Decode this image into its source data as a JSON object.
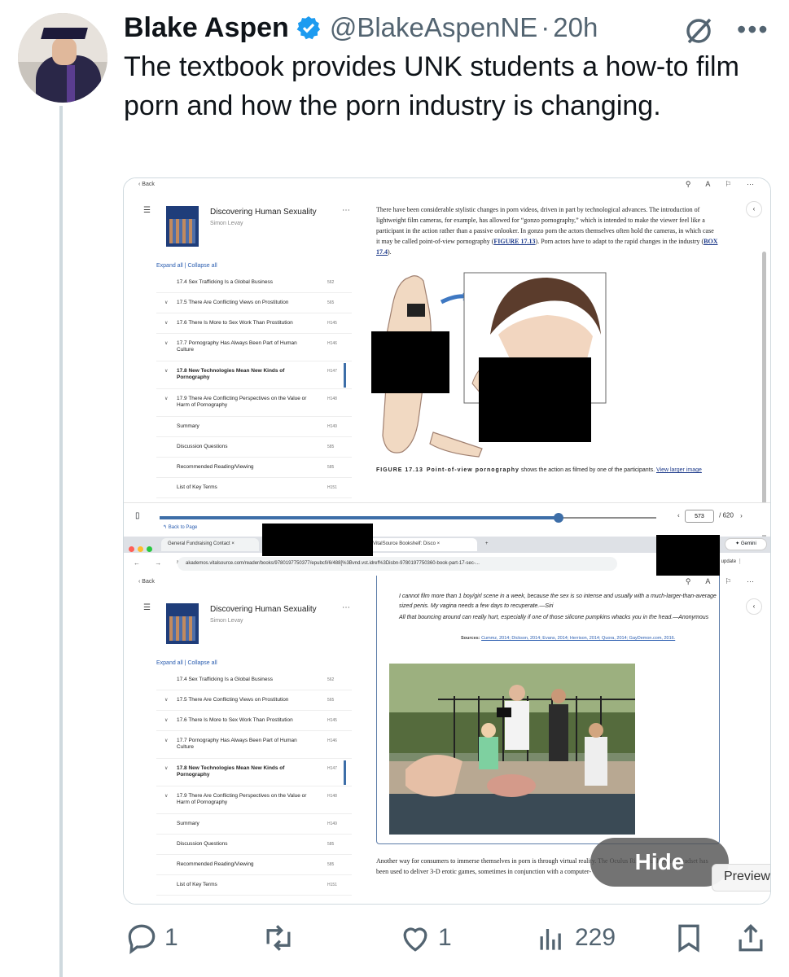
{
  "tweet": {
    "name": "Blake Aspen",
    "handle": "@BlakeAspenNE",
    "separator": "·",
    "time": "20h",
    "text": "The textbook provides UNK students a how-to film porn and how the porn industry is changing.",
    "replies": "1",
    "likes": "1",
    "views": "229"
  },
  "screenshot": {
    "back": "Back",
    "book_title": "Discovering Human Sexuality",
    "book_author": "Simon Levay",
    "expand_all": "Expand all",
    "divider": "|",
    "collapse_all": "Collapse all",
    "toc": [
      {
        "label": "17.4 Sex Trafficking Is a Global Business",
        "page": "562",
        "chev": ""
      },
      {
        "label": "17.5 There Are Conflicting Views on Prostitution",
        "page": "565",
        "chev": "∨"
      },
      {
        "label": "17.6 There Is More to Sex Work Than Prostitution",
        "page": "H145",
        "chev": "∨"
      },
      {
        "label": "17.7 Pornography Has Always Been Part of Human Culture",
        "page": "H146",
        "chev": "∨"
      },
      {
        "label": "17.8 New Technologies Mean New Kinds of Pornography",
        "page": "H147",
        "chev": "∨"
      },
      {
        "label": "17.9 There Are Conflicting Perspectives on the Value or Harm of Pornography",
        "page": "H148",
        "chev": "∨"
      },
      {
        "label": "Summary",
        "page": "H149",
        "chev": ""
      },
      {
        "label": "Discussion Questions",
        "page": "585",
        "chev": ""
      },
      {
        "label": "Recommended Reading/Viewing",
        "page": "585",
        "chev": ""
      },
      {
        "label": "List of Key Terms",
        "page": "H151",
        "chev": ""
      }
    ],
    "para1_a": "There have been considerable stylistic changes in porn videos, driven in part by technological advances. The introduction of lightweight film cameras, for example, has allowed for “gonzo pornography,” which is intended to make the viewer feel like a participant in the action rather than a passive onlooker. In gonzo porn the actors themselves often hold the cameras, in which case it may be called point-of-view pornography (",
    "fig_link": "FIGURE 17.13",
    "para1_b": "). Porn actors have to adapt to the rapid changes in the industry (",
    "box_link": "BOX 17.4",
    "para1_c": ").",
    "caption_label": "FIGURE 17.13",
    "caption_bold": "Point-of-view pornography",
    "caption_text": " shows the action as filmed by one of the participants.",
    "caption_link": "View larger image",
    "page_current": "573",
    "page_total": "/ 620",
    "back_to_page": "Back to Page",
    "tab1": "General Fundraising Contact",
    "tab2": "VitalSource Bookshelf: Disco",
    "tab_close": "×",
    "tab_new": "+",
    "url": "akademos.vitalsource.com/reader/books/9780197750377/epubcfi/6/488[%3Bvnd.vst.idref%3Disbn-9780197750360-book-part-17-sec-...",
    "gemini": "✦ Gemini",
    "update": "h to update ⋮",
    "quote1": "I cannot film more than 1 boy/girl scene in a week, because the sex is so intense and usually with a much-larger-than-average sized penis. My vagina needs a few days to recuperate.—Siri",
    "quote2": "All that bouncing around can really hurt, especially if one of those silicone pumpkins whacks you in the head.—Anonymous",
    "sources_label": "Sources: ",
    "sources": "Cummz, 2014; Dickson, 2014; Evans, 2014; Herrison, 2014; Quora, 2014; GayDemon.com, 2016.",
    "para2": "Another way for consumers to immerse themselves in porn is through virtual reality. The Oculus Rift virtual reality headset has been used to deliver 3-D erotic games, sometimes in conjunction with a computer-",
    "hide": "Hide",
    "preview": "Preview"
  },
  "icons": {
    "verified": "verified-badge-icon",
    "grok": "grok-icon",
    "more": "more-icon",
    "reply": "reply-icon",
    "retweet": "retweet-icon",
    "like": "heart-icon",
    "views": "views-icon",
    "bookmark": "bookmark-icon",
    "share": "share-icon"
  },
  "colors": {
    "verified": "#1d9bf0",
    "secondary": "#536471",
    "link": "#1d3a8a"
  }
}
